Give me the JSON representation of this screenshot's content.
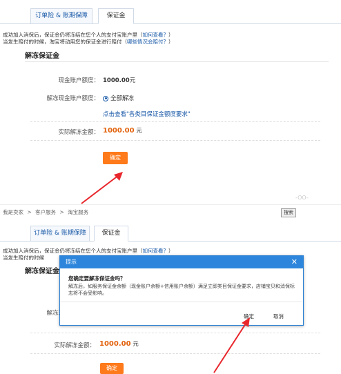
{
  "tabs": [
    "订单险 & 账期保障",
    "保证金"
  ],
  "notice": {
    "line1_prefix": "成功加入消保后，保证金仍将冻结在您个人的支付宝账户里（",
    "line1_link": "如何查看？",
    "line1_suffix": "）",
    "line2_prefix": "当发生赔付的时候，淘宝将动用您的保证金进行赔付（",
    "line2_link": "哪些情况会赔付？",
    "line2_suffix": "）",
    "line1_partial": "成功加入消保后，保证金仍将冻结在您个人的支付宝账户里（",
    "line2_partial": "当发生赔付的时候"
  },
  "section_title": "解冻保证金",
  "form": {
    "cash_label": "现金账户额度：",
    "cash_value": "1000.00",
    "cash_unit": "元",
    "unfreeze_label": "解冻现金账户额度：",
    "unfreeze_option": "全部解冻",
    "requirement_link": "点击查看\"各类目保证金额度要求\"",
    "actual_label": "实际解冻金额：",
    "actual_value": "1000.00",
    "actual_unit": "元",
    "confirm_btn": "确定"
  },
  "breadcrumb": [
    "我是卖家",
    ">",
    "客户服务",
    ">",
    "淘宝服务"
  ],
  "search_btn": "搜索",
  "dialog": {
    "title": "提示",
    "close": "✕",
    "question": "您确定要解冻保证金吗？",
    "message": "解冻后，如服务保证金余额（现金账户余额+信用账户余额）满足立即类目保证金要求，店铺宝贝和消保标志将不会受影响。",
    "ok": "确定",
    "cancel": "取消"
  },
  "watermark": "-OO-"
}
